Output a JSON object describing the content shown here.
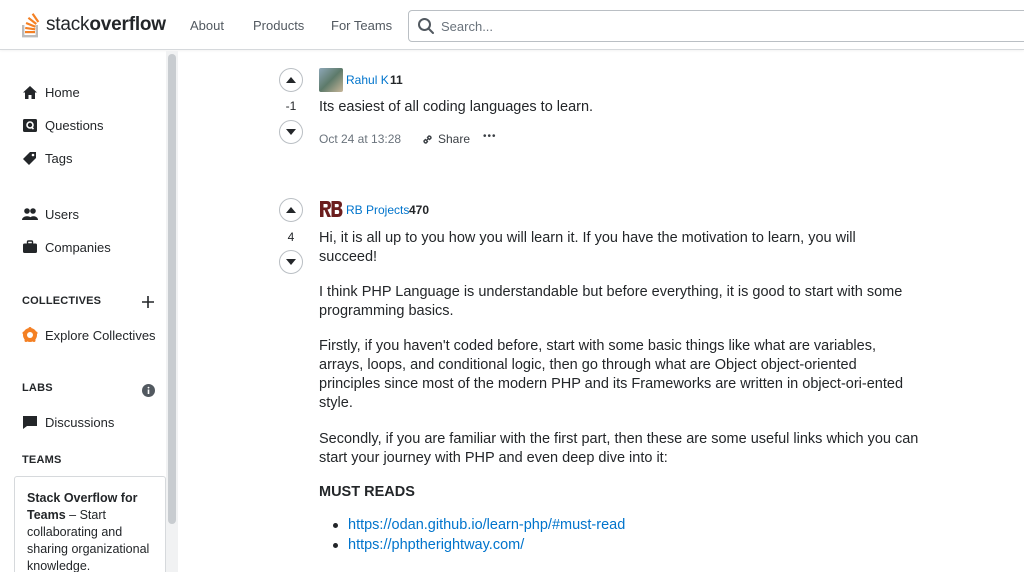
{
  "header": {
    "logo_light": "stack",
    "logo_bold": "overflow",
    "nav": [
      "About",
      "Products",
      "For Teams"
    ],
    "search_placeholder": "Search..."
  },
  "sidebar": {
    "home": "Home",
    "questions": "Questions",
    "tags": "Tags",
    "users": "Users",
    "companies": "Companies",
    "collectives_label": "COLLECTIVES",
    "explore_collectives": "Explore Collectives",
    "labs_label": "LABS",
    "discussions": "Discussions",
    "teams_label": "TEAMS",
    "teams_title": "Stack Overflow for Teams",
    "teams_dash": " – Start collaborating and sharing organizational knowledge."
  },
  "answers": [
    {
      "user": "Rahul K",
      "reputation": "11",
      "score": "-1",
      "text": "Its easiest of all coding languages to learn.",
      "date": "Oct 24 at 13:28",
      "share_label": "Share",
      "more_label": "•••"
    },
    {
      "user": "RB Projects",
      "reputation": "470",
      "score": "4",
      "paragraphs": [
        "Hi, it is all up to you how you will learn it. If you have the motivation to learn, you will succeed!",
        "I think PHP Language is understandable but before everything, it is good to start with some programming basics.",
        "Firstly, if you haven't coded before, start with some basic things like what are variables, arrays, loops, and conditional logic, then go through what are Object object-oriented principles since most of the modern PHP and its Frameworks are written in object-ori-ented style.",
        "Secondly, if you are familiar with the first part, then these are some useful links which you can start your journey with PHP and even deep dive into it:"
      ],
      "heading": "MUST READS",
      "links": [
        "https://odan.github.io/learn-php/#must-read",
        "https://phptherightway.com/"
      ]
    }
  ],
  "colors": {
    "accent": "#f48024",
    "link": "#0074cc",
    "text": "#232629"
  }
}
